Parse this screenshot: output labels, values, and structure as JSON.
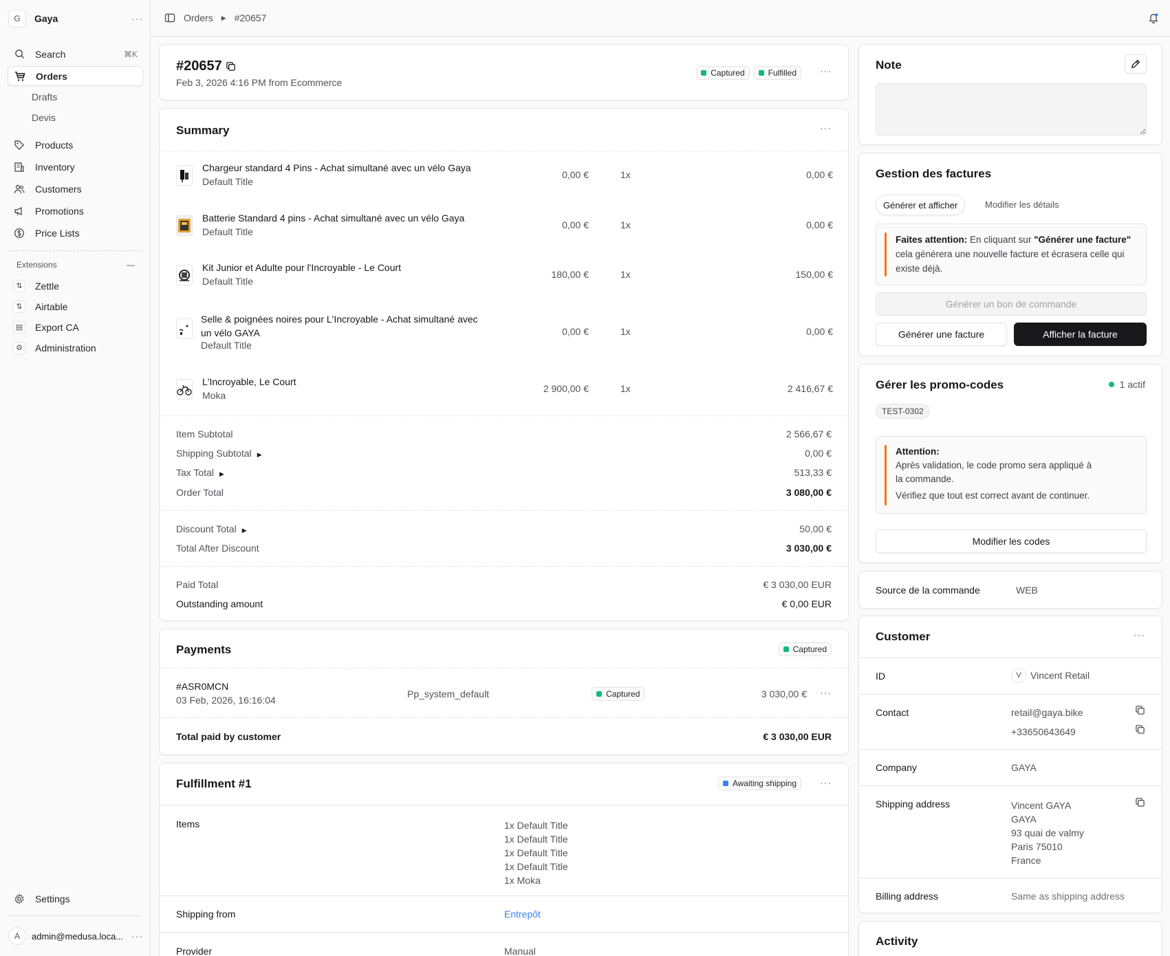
{
  "sidebar": {
    "store_initial": "G",
    "store_name": "Gaya",
    "search_label": "Search",
    "search_shortcut": "⌘K",
    "orders_label": "Orders",
    "drafts_label": "Drafts",
    "devis_label": "Devis",
    "products_label": "Products",
    "inventory_label": "Inventory",
    "customers_label": "Customers",
    "promotions_label": "Promotions",
    "price_lists_label": "Price Lists",
    "extensions_label": "Extensions",
    "zettle_label": "Zettle",
    "airtable_label": "Airtable",
    "export_ca_label": "Export CA",
    "administration_label": "Administration",
    "settings_label": "Settings",
    "user_initial": "A",
    "user_email": "admin@medusa.loca..."
  },
  "topbar": {
    "crumb_orders": "Orders",
    "crumb_order": "#20657"
  },
  "order": {
    "id": "#20657",
    "meta": "Feb 3, 2026 4:16 PM from Ecommerce",
    "badge_payment": "Captured",
    "badge_fulfillment": "Fulfilled"
  },
  "summary": {
    "title": "Summary",
    "items": [
      {
        "name": "Chargeur standard 4 Pins - Achat simultané avec un vélo Gaya",
        "variant": "Default Title",
        "unit": "0,00 €",
        "qty": "1x",
        "total": "0,00 €"
      },
      {
        "name": "Batterie Standard 4 pins - Achat simultané avec un vélo Gaya",
        "variant": "Default Title",
        "unit": "0,00 €",
        "qty": "1x",
        "total": "0,00 €"
      },
      {
        "name": "Kit Junior et Adulte pour l'Incroyable - Le Court",
        "variant": "Default Title",
        "unit": "180,00 €",
        "qty": "1x",
        "total": "150,00 €"
      },
      {
        "name": "Selle & poignées noires pour L'Incroyable - Achat simultané avec un vélo GAYA",
        "variant": "Default Title",
        "unit": "0,00 €",
        "qty": "1x",
        "total": "0,00 €"
      },
      {
        "name": "L'Incroyable, Le Court",
        "variant": "Moka",
        "unit": "2 900,00 €",
        "qty": "1x",
        "total": "2 416,67 €"
      }
    ],
    "item_subtotal_label": "Item Subtotal",
    "item_subtotal": "2 566,67 €",
    "shipping_subtotal_label": "Shipping Subtotal",
    "shipping_subtotal": "0,00 €",
    "tax_total_label": "Tax Total",
    "tax_total": "513,33 €",
    "order_total_label": "Order Total",
    "order_total": "3 080,00 €",
    "discount_total_label": "Discount Total",
    "discount_total": "50,00 €",
    "after_discount_label": "Total After Discount",
    "after_discount": "3 030,00 €",
    "paid_total_label": "Paid Total",
    "paid_total": "€ 3 030,00 EUR",
    "outstanding_label": "Outstanding amount",
    "outstanding": "€ 0,00 EUR"
  },
  "payments": {
    "title": "Payments",
    "badge": "Captured",
    "payment_id": "#ASR0MCN",
    "payment_date": "03 Feb, 2026, 16:16:04",
    "provider": "Pp_system_default",
    "status": "Captured",
    "amount": "3 030,00 €",
    "total_label": "Total paid by customer",
    "total": "€ 3 030,00 EUR"
  },
  "fulfillment": {
    "title": "Fulfillment #1",
    "badge": "Awaiting shipping",
    "items_label": "Items",
    "items": [
      "1x Default Title",
      "1x Default Title",
      "1x Default Title",
      "1x Default Title",
      "1x Moka"
    ],
    "shipping_from_label": "Shipping from",
    "shipping_from": "Entrepôt",
    "provider_label": "Provider",
    "provider": "Manual"
  },
  "note": {
    "title": "Note"
  },
  "invoices": {
    "title": "Gestion des factures",
    "tab_generate": "Générer et afficher",
    "tab_modify": "Modifier les détails",
    "warn_bold": "Faites attention:",
    "warn_text1": " En cliquant sur ",
    "warn_quote": "\"Générer une facture\"",
    "warn_text2": "cela générera une nouvelle facture et écrasera celle qui",
    "warn_text3": "existe déjà.",
    "btn_purchase_order": "Générer un bon de commande",
    "btn_generate": "Générer une facture",
    "btn_show": "Afficher la facture"
  },
  "promo": {
    "title": "Gérer les promo-codes",
    "active": "1 actif",
    "code": "TEST-0302",
    "attention_title": "Attention:",
    "attention_line1": "Après validation, le code promo sera appliqué à",
    "attention_line2": "la commande.",
    "attention_line3": "Vérifiez que tout est correct avant de continuer.",
    "btn_modify": "Modifier les codes"
  },
  "source": {
    "label": "Source de la commande",
    "value": "WEB"
  },
  "customer": {
    "title": "Customer",
    "id_label": "ID",
    "id_initial": "V",
    "id_name": "Vincent Retail",
    "contact_label": "Contact",
    "email": "retail@gaya.bike",
    "phone": "+33650643649",
    "company_label": "Company",
    "company": "GAYA",
    "shipping_label": "Shipping address",
    "shipping_lines": [
      "Vincent GAYA",
      "GAYA",
      "93 quai de valmy",
      "Paris 75010",
      "France"
    ],
    "billing_label": "Billing address",
    "billing": "Same as shipping address"
  },
  "activity": {
    "title": "Activity"
  },
  "colors": {
    "green": "#10b981",
    "blue": "#3b82f6",
    "orange": "#f97316",
    "link": "#3b82f6"
  }
}
